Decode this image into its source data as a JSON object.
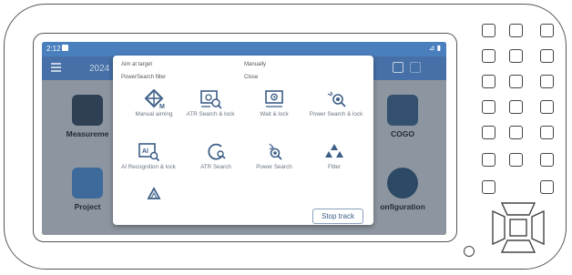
{
  "status": {
    "time": "2:12",
    "right": "⊿ ▮"
  },
  "topbar": {
    "year": "2024"
  },
  "tiles": {
    "measurement": "Measureme",
    "project": "Project",
    "cogo": "COGO",
    "configuration": "onfiguration"
  },
  "popup": {
    "aim_heading": "Aim at target",
    "powersearch_heading": "PowerSearch filter",
    "manually_heading": "Manually",
    "close_heading": "Close",
    "items": [
      {
        "label": "Manual aiming",
        "icon": "manual-aiming-icon"
      },
      {
        "label": "ATR Search & lock",
        "icon": "atr-search-lock-icon"
      },
      {
        "label": "Wait & lock",
        "icon": "wait-lock-icon"
      },
      {
        "label": "Power Search & lock",
        "icon": "power-search-lock-icon"
      },
      {
        "label": "AI Recognition & lock",
        "icon": "ai-recognition-icon"
      },
      {
        "label": "ATR Search",
        "icon": "atr-search-icon"
      },
      {
        "label": "Power Search",
        "icon": "power-search-icon"
      },
      {
        "label": "Filter",
        "icon": "filter-icon"
      },
      {
        "label": "",
        "icon": "prism-icon"
      }
    ],
    "stop_track": "Stop track"
  },
  "colors": {
    "statusbar": "#4a7fbe",
    "topbar": "#4670a7",
    "icon_blue": "#3b5d86",
    "screen_dim": "#8d96a0"
  }
}
